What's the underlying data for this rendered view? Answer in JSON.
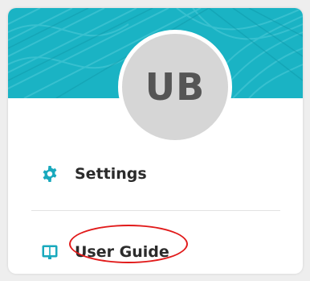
{
  "profile": {
    "initials": "UB"
  },
  "menu": {
    "items": [
      {
        "label": "Settings",
        "icon": "gear-icon"
      },
      {
        "label": "User Guide",
        "icon": "book-icon"
      }
    ]
  },
  "colors": {
    "banner": "#1ab3c4",
    "icon_accent": "#19a9bd",
    "avatar_bg": "#d6d6d6",
    "highlight": "#e11a1a"
  }
}
